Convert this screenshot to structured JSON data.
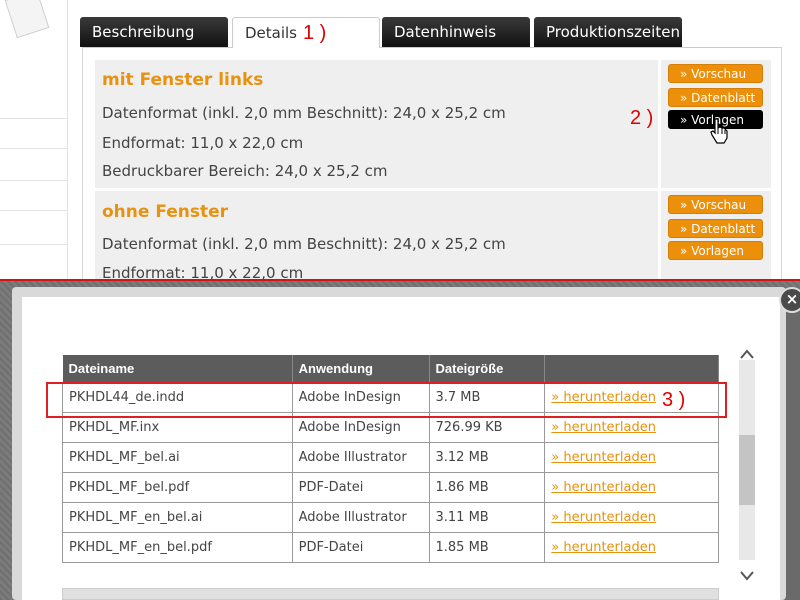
{
  "tabs": [
    {
      "label": "Beschreibung",
      "active": false
    },
    {
      "label": "Details",
      "active": true
    },
    {
      "label": "Datenhinweis",
      "active": false
    },
    {
      "label": "Produktionszeiten",
      "active": false
    }
  ],
  "annotations": {
    "step1": "1 )",
    "step2": "2 )",
    "step3": "3 )"
  },
  "products": [
    {
      "title": "mit Fenster links",
      "specs": [
        "Datenformat (inkl. 2,0 mm Beschnitt): 24,0 x 25,2 cm",
        "Endformat: 11,0 x 22,0 cm",
        "Bedruckbarer Bereich: 24,0 x 25,2 cm"
      ],
      "buttons": [
        "» Vorschau",
        "» Datenblatt",
        "» Vorlagen"
      ]
    },
    {
      "title": "ohne Fenster",
      "specs": [
        "Datenformat (inkl. 2,0 mm Beschnitt): 24,0 x 25,2 cm",
        "Endformat: 11,0 x 22,0 cm"
      ],
      "buttons": [
        "» Vorschau",
        "» Datenblatt",
        "» Vorlagen"
      ]
    }
  ],
  "modal": {
    "close_label": "×",
    "columns": [
      "Dateiname",
      "Anwendung",
      "Dateigröße",
      ""
    ],
    "rows": [
      {
        "name": "PKHDL44_de.indd",
        "app": "Adobe InDesign",
        "size": "3.7 MB",
        "action": "»  herunterladen"
      },
      {
        "name": "PKHDL_MF.inx",
        "app": "Adobe InDesign",
        "size": "726.99 KB",
        "action": "»  herunterladen"
      },
      {
        "name": "PKHDL_MF_bel.ai",
        "app": "Adobe Illustrator",
        "size": "3.12 MB",
        "action": "»  herunterladen"
      },
      {
        "name": "PKHDL_MF_bel.pdf",
        "app": "PDF-Datei",
        "size": "1.86 MB",
        "action": "»  herunterladen"
      },
      {
        "name": "PKHDL_MF_en_bel.ai",
        "app": "Adobe Illustrator",
        "size": "3.11 MB",
        "action": "»  herunterladen"
      },
      {
        "name": "PKHDL_MF_en_bel.pdf",
        "app": "PDF-Datei",
        "size": "1.85 MB",
        "action": "»  herunterladen"
      }
    ]
  },
  "colors": {
    "accent": "#e8920f",
    "button": "#ec8f0b",
    "annotation": "#e00000",
    "header": "#5c5c5c"
  },
  "icons": [
    "hand-cursor-icon",
    "close-icon",
    "scroll-up-icon",
    "scroll-down-icon"
  ]
}
